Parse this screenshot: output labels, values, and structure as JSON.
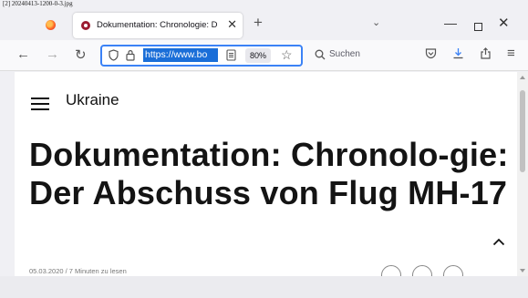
{
  "file_caption": "[2] 20240413-1200-0-3.jpg",
  "browser": {
    "tab": {
      "title": "Dokumentation: Chronologie: D",
      "close": "✕"
    },
    "new_tab": "+",
    "list_tabs": "⌄",
    "window": {
      "minimize": "—",
      "close": "✕"
    },
    "nav": {
      "url": "https://www.bo",
      "zoom": "80%",
      "search_placeholder": "Suchen"
    }
  },
  "page": {
    "section": "Ukraine",
    "headline": "Dokumentation: Chronolo-gie: Der Abschuss von Flug MH-17",
    "meta": "05.03.2020 / 7 Minuten zu lesen"
  },
  "colors": {
    "url_highlight": "#1a6ed8",
    "tab_favicon": "#9b1b30",
    "focus_ring": "#3b82f6"
  }
}
